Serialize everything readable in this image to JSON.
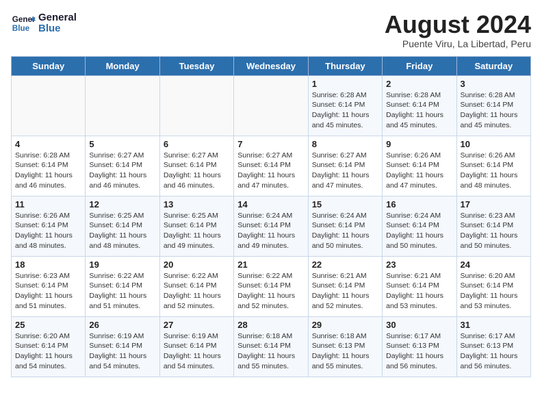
{
  "header": {
    "logo_line1": "General",
    "logo_line2": "Blue",
    "month": "August 2024",
    "location": "Puente Viru, La Libertad, Peru"
  },
  "days_of_week": [
    "Sunday",
    "Monday",
    "Tuesday",
    "Wednesday",
    "Thursday",
    "Friday",
    "Saturday"
  ],
  "weeks": [
    [
      {
        "day": "",
        "info": ""
      },
      {
        "day": "",
        "info": ""
      },
      {
        "day": "",
        "info": ""
      },
      {
        "day": "",
        "info": ""
      },
      {
        "day": "1",
        "info": "Sunrise: 6:28 AM\nSunset: 6:14 PM\nDaylight: 11 hours\nand 45 minutes."
      },
      {
        "day": "2",
        "info": "Sunrise: 6:28 AM\nSunset: 6:14 PM\nDaylight: 11 hours\nand 45 minutes."
      },
      {
        "day": "3",
        "info": "Sunrise: 6:28 AM\nSunset: 6:14 PM\nDaylight: 11 hours\nand 45 minutes."
      }
    ],
    [
      {
        "day": "4",
        "info": "Sunrise: 6:28 AM\nSunset: 6:14 PM\nDaylight: 11 hours\nand 46 minutes."
      },
      {
        "day": "5",
        "info": "Sunrise: 6:27 AM\nSunset: 6:14 PM\nDaylight: 11 hours\nand 46 minutes."
      },
      {
        "day": "6",
        "info": "Sunrise: 6:27 AM\nSunset: 6:14 PM\nDaylight: 11 hours\nand 46 minutes."
      },
      {
        "day": "7",
        "info": "Sunrise: 6:27 AM\nSunset: 6:14 PM\nDaylight: 11 hours\nand 47 minutes."
      },
      {
        "day": "8",
        "info": "Sunrise: 6:27 AM\nSunset: 6:14 PM\nDaylight: 11 hours\nand 47 minutes."
      },
      {
        "day": "9",
        "info": "Sunrise: 6:26 AM\nSunset: 6:14 PM\nDaylight: 11 hours\nand 47 minutes."
      },
      {
        "day": "10",
        "info": "Sunrise: 6:26 AM\nSunset: 6:14 PM\nDaylight: 11 hours\nand 48 minutes."
      }
    ],
    [
      {
        "day": "11",
        "info": "Sunrise: 6:26 AM\nSunset: 6:14 PM\nDaylight: 11 hours\nand 48 minutes."
      },
      {
        "day": "12",
        "info": "Sunrise: 6:25 AM\nSunset: 6:14 PM\nDaylight: 11 hours\nand 48 minutes."
      },
      {
        "day": "13",
        "info": "Sunrise: 6:25 AM\nSunset: 6:14 PM\nDaylight: 11 hours\nand 49 minutes."
      },
      {
        "day": "14",
        "info": "Sunrise: 6:24 AM\nSunset: 6:14 PM\nDaylight: 11 hours\nand 49 minutes."
      },
      {
        "day": "15",
        "info": "Sunrise: 6:24 AM\nSunset: 6:14 PM\nDaylight: 11 hours\nand 50 minutes."
      },
      {
        "day": "16",
        "info": "Sunrise: 6:24 AM\nSunset: 6:14 PM\nDaylight: 11 hours\nand 50 minutes."
      },
      {
        "day": "17",
        "info": "Sunrise: 6:23 AM\nSunset: 6:14 PM\nDaylight: 11 hours\nand 50 minutes."
      }
    ],
    [
      {
        "day": "18",
        "info": "Sunrise: 6:23 AM\nSunset: 6:14 PM\nDaylight: 11 hours\nand 51 minutes."
      },
      {
        "day": "19",
        "info": "Sunrise: 6:22 AM\nSunset: 6:14 PM\nDaylight: 11 hours\nand 51 minutes."
      },
      {
        "day": "20",
        "info": "Sunrise: 6:22 AM\nSunset: 6:14 PM\nDaylight: 11 hours\nand 52 minutes."
      },
      {
        "day": "21",
        "info": "Sunrise: 6:22 AM\nSunset: 6:14 PM\nDaylight: 11 hours\nand 52 minutes."
      },
      {
        "day": "22",
        "info": "Sunrise: 6:21 AM\nSunset: 6:14 PM\nDaylight: 11 hours\nand 52 minutes."
      },
      {
        "day": "23",
        "info": "Sunrise: 6:21 AM\nSunset: 6:14 PM\nDaylight: 11 hours\nand 53 minutes."
      },
      {
        "day": "24",
        "info": "Sunrise: 6:20 AM\nSunset: 6:14 PM\nDaylight: 11 hours\nand 53 minutes."
      }
    ],
    [
      {
        "day": "25",
        "info": "Sunrise: 6:20 AM\nSunset: 6:14 PM\nDaylight: 11 hours\nand 54 minutes."
      },
      {
        "day": "26",
        "info": "Sunrise: 6:19 AM\nSunset: 6:14 PM\nDaylight: 11 hours\nand 54 minutes."
      },
      {
        "day": "27",
        "info": "Sunrise: 6:19 AM\nSunset: 6:14 PM\nDaylight: 11 hours\nand 54 minutes."
      },
      {
        "day": "28",
        "info": "Sunrise: 6:18 AM\nSunset: 6:14 PM\nDaylight: 11 hours\nand 55 minutes."
      },
      {
        "day": "29",
        "info": "Sunrise: 6:18 AM\nSunset: 6:13 PM\nDaylight: 11 hours\nand 55 minutes."
      },
      {
        "day": "30",
        "info": "Sunrise: 6:17 AM\nSunset: 6:13 PM\nDaylight: 11 hours\nand 56 minutes."
      },
      {
        "day": "31",
        "info": "Sunrise: 6:17 AM\nSunset: 6:13 PM\nDaylight: 11 hours\nand 56 minutes."
      }
    ]
  ]
}
